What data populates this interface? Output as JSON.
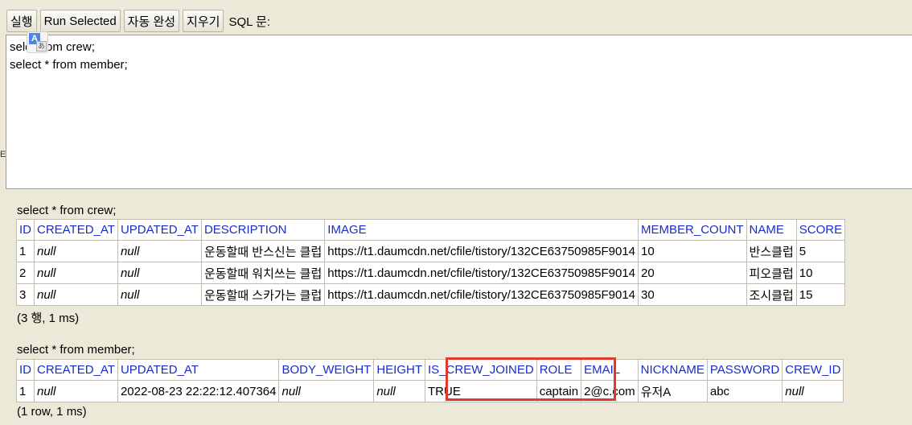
{
  "toolbar": {
    "run_label": "실행",
    "run_selected_label": "Run Selected",
    "autocomplete_label": "자동 완성",
    "clear_label": "지우기",
    "sql_label": "SQL 문:"
  },
  "editor": {
    "text": "sele  from crew;\nselect * from member;"
  },
  "left_mark": "E",
  "translate_icon": {
    "a": "A",
    "b": "あ"
  },
  "crew_result": {
    "query": "select * from crew;",
    "columns": [
      "ID",
      "CREATED_AT",
      "UPDATED_AT",
      "DESCRIPTION",
      "IMAGE",
      "MEMBER_COUNT",
      "NAME",
      "SCORE"
    ],
    "rows": [
      [
        "1",
        "null",
        "null",
        "운동할때 반스신는 클럽",
        "https://t1.daumcdn.net/cfile/tistory/132CE63750985F9014",
        "10",
        "반스클럽",
        "5"
      ],
      [
        "2",
        "null",
        "null",
        "운동할때 워치쓰는 클럽",
        "https://t1.daumcdn.net/cfile/tistory/132CE63750985F9014",
        "20",
        "피오클럽",
        "10"
      ],
      [
        "3",
        "null",
        "null",
        "운동할때 스카가는 클럽",
        "https://t1.daumcdn.net/cfile/tistory/132CE63750985F9014",
        "30",
        "조시클럽",
        "15"
      ]
    ],
    "status": "(3 행, 1 ms)"
  },
  "member_result": {
    "query": "select * from member;",
    "columns": [
      "ID",
      "CREATED_AT",
      "UPDATED_AT",
      "BODY_WEIGHT",
      "HEIGHT",
      "IS_CREW_JOINED",
      "ROLE",
      "EMAIL",
      "NICKNAME",
      "PASSWORD",
      "CREW_ID"
    ],
    "rows": [
      [
        "1",
        "null",
        "2022-08-23 22:22:12.407364",
        "null",
        "null",
        "TRUE",
        "captain",
        "2@c.com",
        "유저A",
        "abc",
        "null"
      ]
    ],
    "status": "(1 row, 1 ms)"
  },
  "colors": {
    "header_text": "#1a2cc8",
    "highlight": "#e03a2e",
    "background": "#ece9d8"
  }
}
